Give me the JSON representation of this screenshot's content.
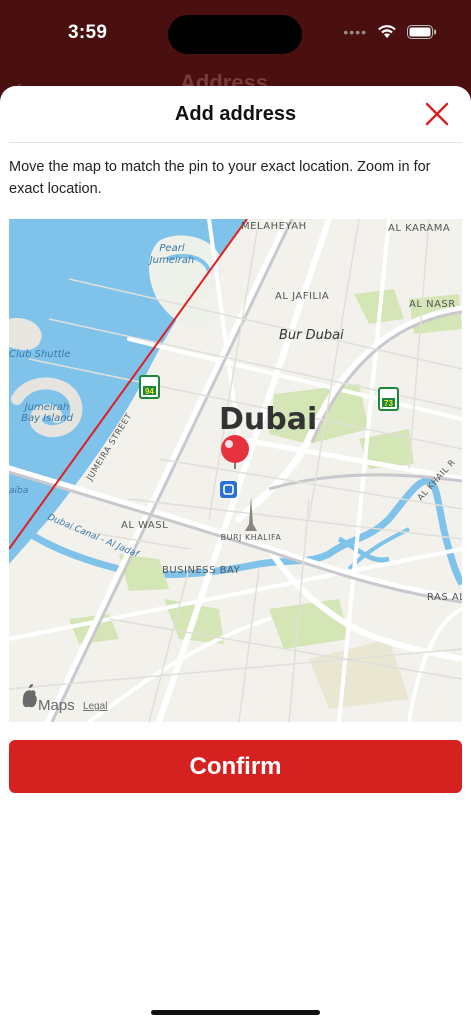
{
  "status": {
    "time": "3:59"
  },
  "background_page": {
    "title": "Address"
  },
  "sheet": {
    "title": "Add address",
    "instructions": "Move the map to match the pin to your exact location. Zoom in for exact location.",
    "confirm_label": "Confirm"
  },
  "map": {
    "labels": {
      "melaheyah": "MELAHEYAH",
      "al_karama": "AL KARAMA",
      "pearl": "Pearl",
      "jumeirah": "Jumeirah",
      "al_jafilia": "AL JAFILIA",
      "al_nasr": "AL NASR",
      "bur_dubai": "Bur Dubai",
      "club_shuttle": "Club Shuttle",
      "jumeirah_bay1": "Jumeirah",
      "jumeirah_bay2": "Bay Island",
      "dubai": "Dubai",
      "jumeira_street": "JUMEIRA STREET",
      "al_khail": "AL KHAIL R",
      "dubai_canal": "Dubai Canal - Al Jadaf",
      "al_wasl": "AL WASL",
      "burj_khalifa": "BURJ KHALIFA",
      "business_bay": "BUSINESS BAY",
      "ras_al": "RAS AL",
      "aiba": "aiba",
      "route_94": "94",
      "route_73": "73",
      "maps_brand": "Maps",
      "legal": "Legal"
    },
    "colors": {
      "water": "#7fc3ea",
      "land": "#f3f1ec",
      "park": "#d4e6b5",
      "road": "#ffffff",
      "pin": "#e5323e",
      "boundary": "#e02020"
    }
  },
  "colors": {
    "accent": "#d52221",
    "background": "#4a0f0f"
  }
}
